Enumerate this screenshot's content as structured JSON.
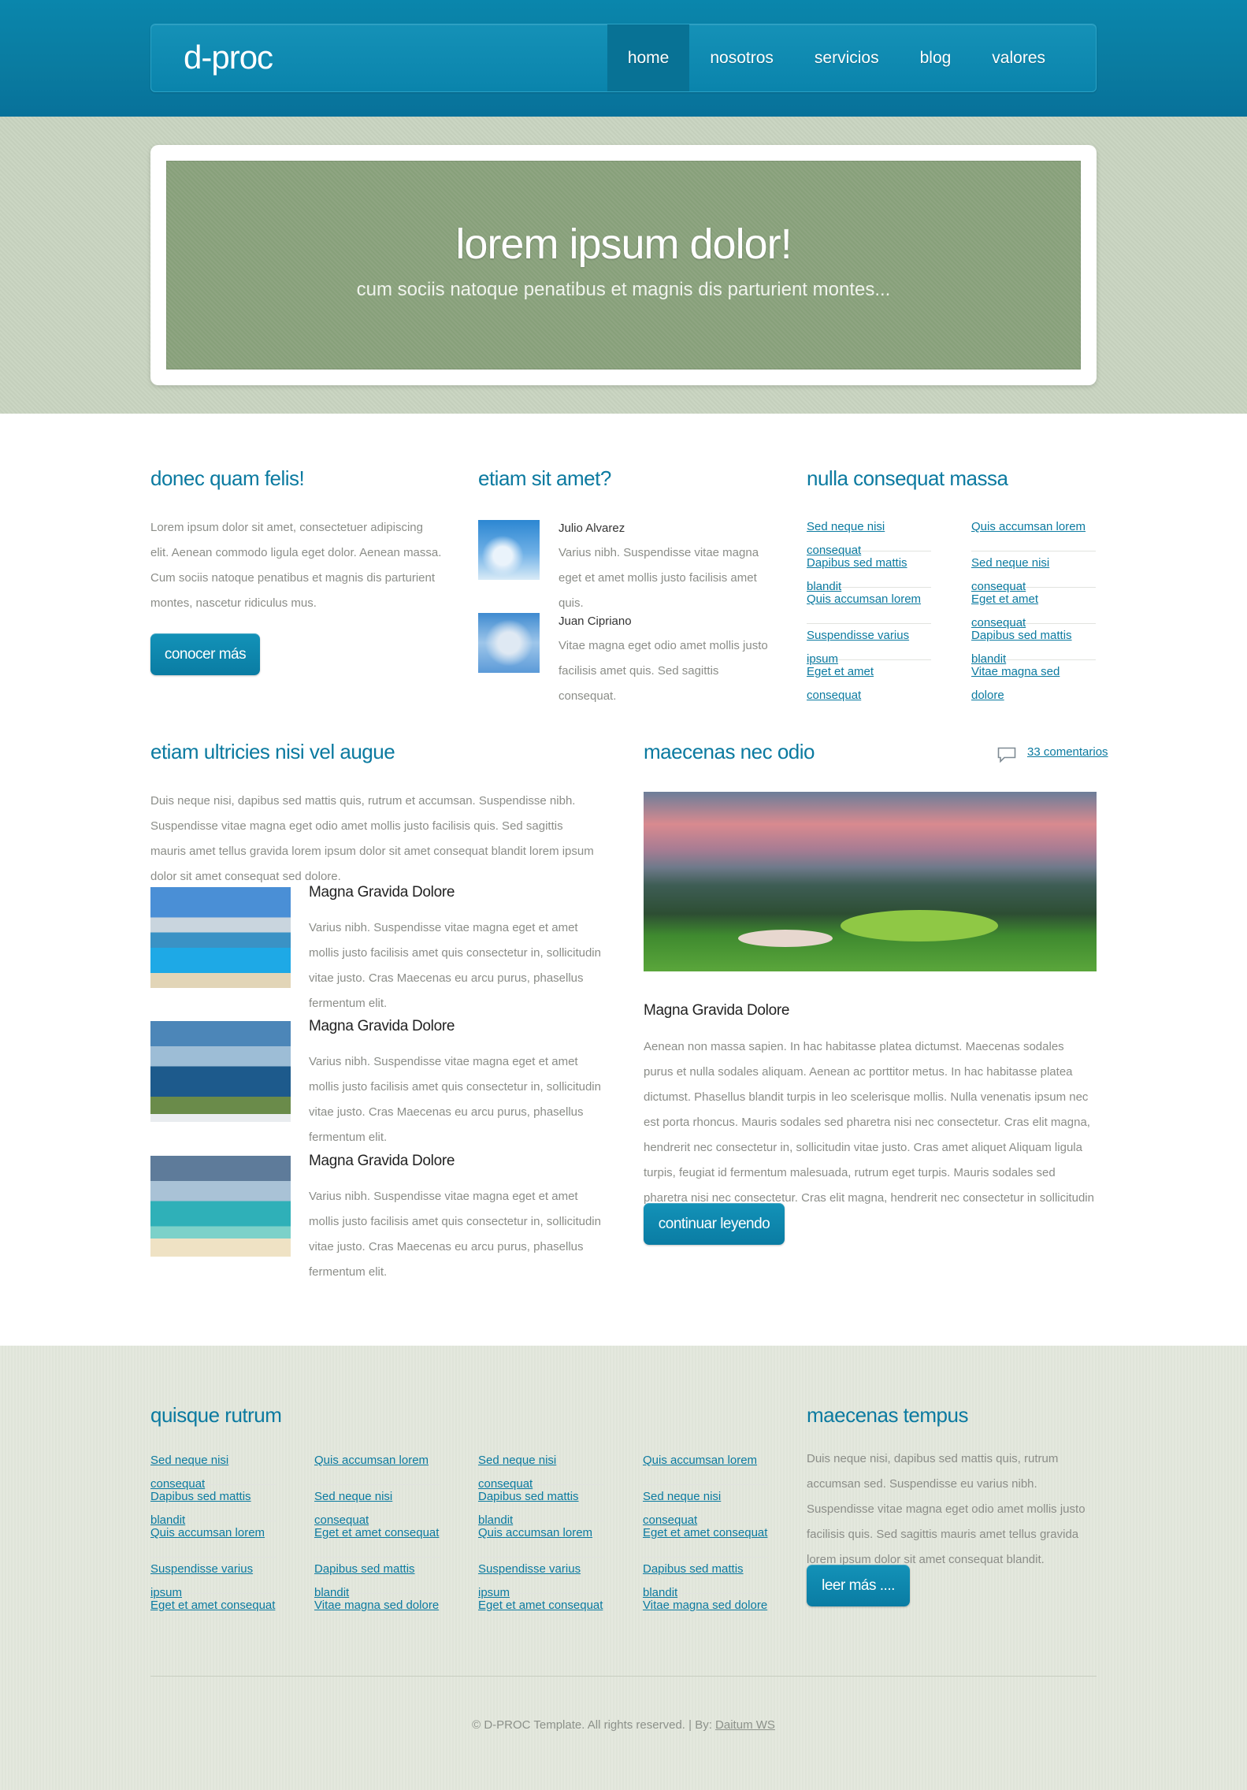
{
  "header": {
    "logo": "d-proc",
    "menu": [
      "home",
      "nosotros",
      "servicios",
      "blog",
      "valores"
    ]
  },
  "hero": {
    "title": "lorem ipsum dolor!",
    "subtitle": "cum sociis natoque penatibus et magnis dis parturient montes..."
  },
  "col1": {
    "title": "donec quam felis!",
    "text": "Lorem ipsum dolor sit amet, consectetuer adipiscing elit. Aenean commodo ligula eget dolor. Aenean massa. Cum sociis natoque penatibus et magnis dis parturient montes, nascetur ridiculus mus.",
    "button": "conocer más"
  },
  "col2": {
    "title": "etiam sit amet?",
    "people": [
      {
        "name": "Julio Alvarez",
        "text": "Varius nibh. Suspendisse vitae magna eget et amet mollis justo facilisis amet quis."
      },
      {
        "name": "Juan Cipriano",
        "text": "Vitae magna eget odio amet mollis justo facilisis amet quis. Sed sagittis consequat."
      }
    ]
  },
  "col3": {
    "title": "nulla consequat massa",
    "links_left": [
      "Sed neque nisi consequat",
      "Dapibus sed mattis blandit",
      "Quis accumsan lorem",
      "Suspendisse varius ipsum",
      "Eget et amet consequat"
    ],
    "links_right": [
      "Quis accumsan lorem",
      "Sed neque nisi consequat",
      "Eget et amet consequat",
      "Dapibus sed mattis blandit",
      "Vitae magna sed dolore"
    ]
  },
  "left_section": {
    "title": "etiam ultricies nisi vel augue",
    "intro": "Duis neque nisi, dapibus sed mattis quis, rutrum et accumsan. Suspendisse nibh. Suspendisse vitae magna eget odio amet mollis justo facilisis quis. Sed sagittis mauris amet tellus gravida lorem ipsum dolor sit amet consequat blandit lorem ipsum dolor sit amet consequat sed dolore.",
    "items": [
      {
        "title": "Magna Gravida Dolore",
        "text": "Varius nibh. Suspendisse vitae magna eget et amet mollis justo facilisis amet quis consectetur in, sollicitudin vitae justo. Cras Maecenas eu arcu purus, phasellus fermentum elit."
      },
      {
        "title": "Magna Gravida Dolore",
        "text": "Varius nibh. Suspendisse vitae magna eget et amet mollis justo facilisis amet quis consectetur in, sollicitudin vitae justo. Cras Maecenas eu arcu purus, phasellus fermentum elit."
      },
      {
        "title": "Magna Gravida Dolore",
        "text": "Varius nibh. Suspendisse vitae magna eget et amet mollis justo facilisis amet quis consectetur in, sollicitudin vitae justo. Cras Maecenas eu arcu purus, phasellus fermentum elit."
      }
    ]
  },
  "right_section": {
    "title": "maecenas nec odio",
    "comments": "33 comentarios",
    "post_title": "Magna Gravida Dolore",
    "post_text": "Aenean non massa sapien. In hac habitasse platea dictumst. Maecenas sodales purus et nulla sodales aliquam. Aenean ac porttitor metus. In hac habitasse platea dictumst. Phasellus blandit turpis in leo scelerisque mollis. Nulla venenatis ipsum nec est porta rhoncus. Mauris sodales sed pharetra nisi nec consectetur. Cras elit magna, hendrerit nec consectetur in, sollicitudin vitae justo. Cras amet aliquet Aliquam ligula turpis, feugiat id fermentum malesuada, rutrum eget turpis. Mauris sodales sed pharetra nisi nec consectetur. Cras elit magna, hendrerit nec consectetur in sollicitudin vitae.",
    "button": "continuar leyendo"
  },
  "footer": {
    "title_left": "quisque rutrum",
    "columns": [
      [
        "Sed neque nisi consequat",
        "Dapibus sed mattis blandit",
        "Quis accumsan lorem",
        "Suspendisse varius ipsum",
        "Eget et amet consequat"
      ],
      [
        "Quis accumsan lorem",
        "Sed neque nisi consequat",
        "Eget et amet consequat",
        "Dapibus sed mattis blandit",
        "Vitae magna sed dolore"
      ],
      [
        "Sed neque nisi consequat",
        "Dapibus sed mattis blandit",
        "Quis accumsan lorem",
        "Suspendisse varius ipsum",
        "Eget et amet consequat"
      ],
      [
        "Quis accumsan lorem",
        "Sed neque nisi consequat",
        "Eget et amet consequat",
        "Dapibus sed mattis blandit",
        "Vitae magna sed dolore"
      ]
    ],
    "title_right": "maecenas tempus",
    "text_right": "Duis neque nisi, dapibus sed mattis quis, rutrum accumsan sed. Suspendisse eu varius nibh. Suspendisse vitae magna eget odio amet mollis justo facilisis quis. Sed sagittis mauris amet tellus gravida lorem ipsum dolor sit amet consequat blandit.",
    "button": "leer más ....",
    "copyright": "© D-PROC Template. All rights reserved. | By:",
    "credit": "Daitum WS"
  },
  "colors": {
    "brand": "#0a84ac",
    "accent_text": "#0b7aa0",
    "hero_green": "#8fa582"
  }
}
